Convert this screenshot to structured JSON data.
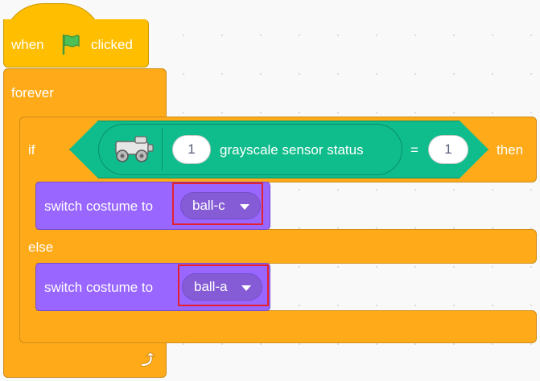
{
  "hat": {
    "when": "when",
    "clicked": "clicked",
    "flag_icon": "green-flag-icon"
  },
  "forever": {
    "label": "forever",
    "loop_icon": "loop-arrow-icon"
  },
  "if_else": {
    "if_label": "if",
    "then_label": "then",
    "else_label": "else"
  },
  "condition": {
    "sensor_icon": "robot-car-icon",
    "sensor_port": "1",
    "reporter_label": "grayscale sensor status",
    "operator": "=",
    "compare_value": "1"
  },
  "if_branch": {
    "label": "switch costume to",
    "costume": "ball-c"
  },
  "else_branch": {
    "label": "switch costume to",
    "costume": "ball-a"
  },
  "colors": {
    "events": "#ffbf00",
    "control": "#ffab19",
    "looks": "#9966ff",
    "operators": "#0fbd8c",
    "highlight": "#e5202e"
  }
}
